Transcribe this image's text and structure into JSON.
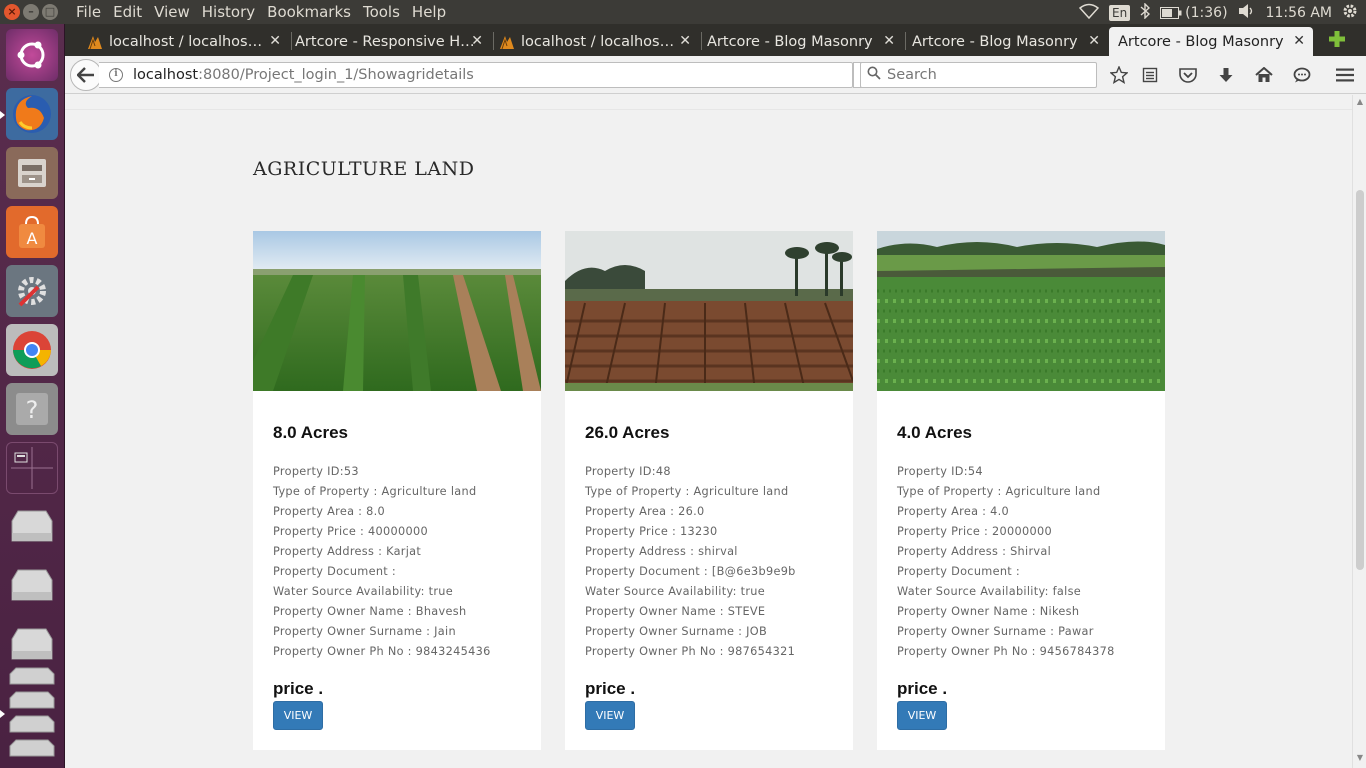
{
  "topbar": {
    "menu": [
      "File",
      "Edit",
      "View",
      "History",
      "Bookmarks",
      "Tools",
      "Help"
    ],
    "lang": "En",
    "battery": "(1:36)",
    "clock": "11:56 AM"
  },
  "tabs": [
    {
      "title": "localhost / localhos…",
      "icon": "phpmyadmin-icon"
    },
    {
      "title": "Artcore - Responsive H…",
      "icon": ""
    },
    {
      "title": "localhost / localhos…",
      "icon": "phpmyadmin-icon"
    },
    {
      "title": "Artcore - Blog Masonry",
      "icon": ""
    },
    {
      "title": "Artcore - Blog Masonry",
      "icon": ""
    },
    {
      "title": "Artcore - Blog Masonry",
      "icon": "",
      "active": true
    }
  ],
  "navbar": {
    "url_host": "localhost",
    "url_rest": ":8080/Project_login_1/Showagridetails",
    "search_placeholder": "Search"
  },
  "page": {
    "title": "AGRICULTURE LAND",
    "cards": [
      {
        "heading": "8.0 Acres",
        "image": "green crop field",
        "details": [
          "Property ID:53",
          "Type of Property : Agriculture land",
          "Property Area : 8.0",
          "Property Price : 40000000",
          "Property Address : Karjat",
          "Property Document :",
          "Water Source Availability: true",
          "Property Owner Name : Bhavesh",
          "Property Owner Surname : Jain",
          "Property Owner Ph No : 9843245436"
        ],
        "price_label": "price .",
        "button": "VIEW"
      },
      {
        "heading": "26.0 Acres",
        "image": "ploughed brown field",
        "details": [
          "Property ID:48",
          "Type of Property : Agriculture land",
          "Property Area : 26.0",
          "Property Price : 13230",
          "Property Address : shirval",
          "Property Document : [B@6e3b9e9b",
          "Water Source Availability: true",
          "Property Owner Name : STEVE",
          "Property Owner Surname : JOB",
          "Property Owner Ph No : 987654321"
        ],
        "price_label": "price .",
        "button": "VIEW"
      },
      {
        "heading": "4.0 Acres",
        "image": "rice paddy field",
        "details": [
          "Property ID:54",
          "Type of Property : Agriculture land",
          "Property Area : 4.0",
          "Property Price : 20000000",
          "Property Address : Shirval",
          "Property Document :",
          "Water Source Availability: false",
          "Property Owner Name : Nikesh",
          "Property Owner Surname : Pawar",
          "Property Owner Ph No : 9456784378"
        ],
        "price_label": "price .",
        "button": "VIEW"
      }
    ]
  },
  "colors": {
    "button": "#337ab7",
    "launcher": "#4a2242",
    "panel": "#3c3b37"
  }
}
